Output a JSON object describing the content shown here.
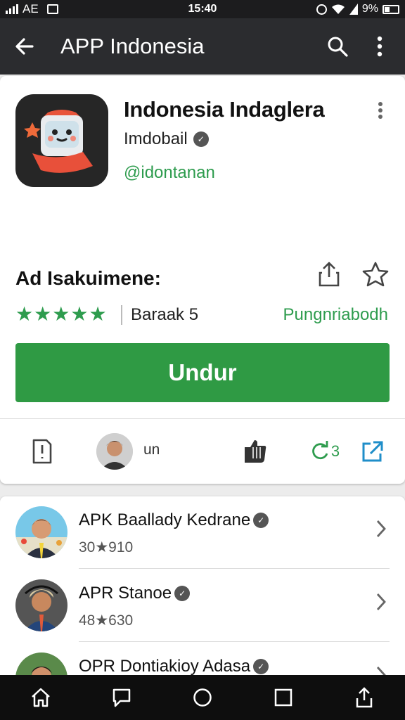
{
  "status_bar": {
    "time": "15:40",
    "carrier": "AE",
    "battery": "9%"
  },
  "toolbar": {
    "title": "APP Indonesia",
    "back_icon": "arrow-left-icon",
    "search_icon": "search-icon",
    "more_icon": "more-vertical-icon"
  },
  "app": {
    "name": "Indonesia Indaglera",
    "developer": "Imdobail",
    "handle": "@idontanan",
    "section_title": "Ad Isakuimene:",
    "rating_label": "Baraak 5",
    "rating_link": "Pungnriabodh",
    "install_label": "Undur",
    "stars": 5
  },
  "actions": {
    "user_text": "un",
    "count": "3"
  },
  "related": [
    {
      "title": "APK Baallady Kedrane",
      "sub": "30★910"
    },
    {
      "title": "APR Stanoe",
      "sub": "48★630"
    },
    {
      "title": "OPR Dontiakioy Adasa",
      "sub": ""
    }
  ],
  "colors": {
    "accent": "#2f9a44",
    "toolbar": "#2b2c2f",
    "statusbar": "#1c1c1e",
    "navbar": "#0e0e0e"
  }
}
